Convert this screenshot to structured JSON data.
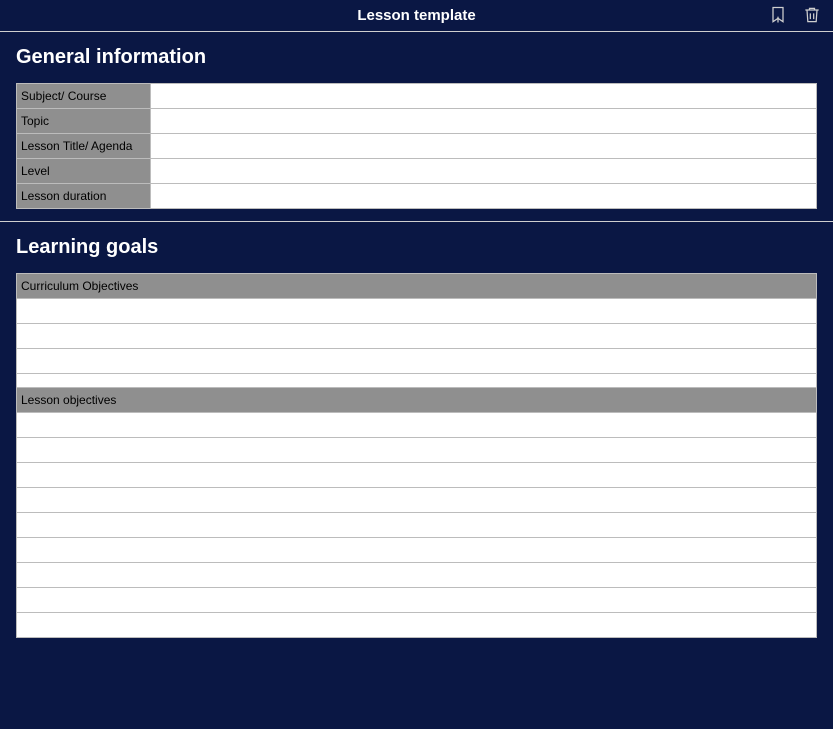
{
  "header": {
    "title": "Lesson template"
  },
  "sections": {
    "general": {
      "title": "General information",
      "rows": [
        {
          "label": "Subject/ Course",
          "value": ""
        },
        {
          "label": "Topic",
          "value": ""
        },
        {
          "label": "Lesson Title/ Agenda",
          "value": ""
        },
        {
          "label": "Level",
          "value": ""
        },
        {
          "label": "Lesson duration",
          "value": ""
        }
      ]
    },
    "goals": {
      "title": "Learning goals",
      "curriculum_header": "Curriculum Objectives",
      "lesson_header": "Lesson objectives"
    }
  }
}
